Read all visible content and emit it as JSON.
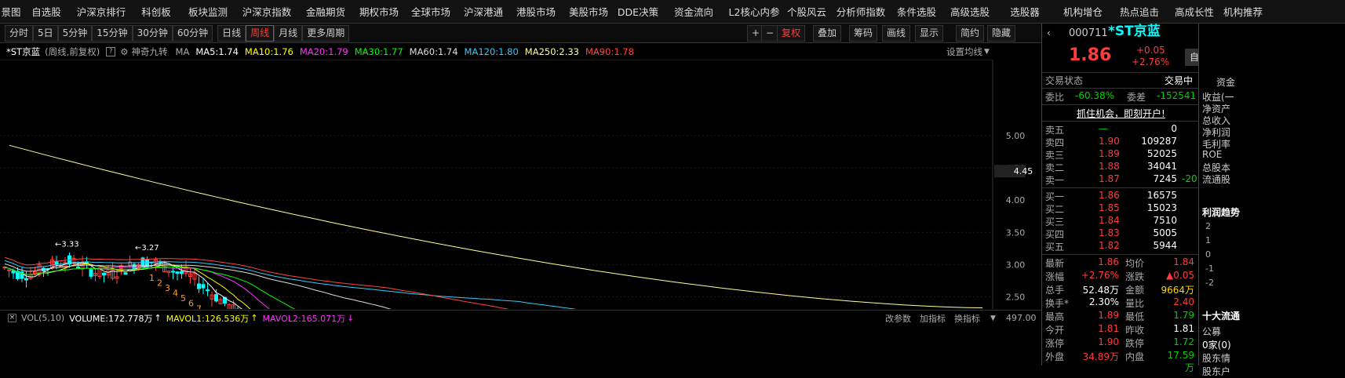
{
  "nav": [
    "景图",
    "自选股",
    "沪深京排行",
    "科创板",
    "板块监测",
    "沪深京指数",
    "金融期货",
    "期权市场",
    "全球市场",
    "沪深港通",
    "港股市场",
    "美股市场",
    "DDE决策",
    "资金流向",
    "L2核心内参",
    "个股风云",
    "分析师指数",
    "条件选股",
    "高级选股",
    "选股器",
    "机构增仓",
    "热点追击",
    "高成长性",
    "机构推荐"
  ],
  "toolbar": {
    "periods": [
      "分时",
      "5日",
      "5分钟",
      "15分钟",
      "30分钟",
      "60分钟",
      "日线",
      "周线",
      "月线",
      "更多周期"
    ],
    "active": "周线",
    "right": [
      "+",
      "−",
      "复权",
      "叠加",
      "筹码",
      "画线",
      "显示",
      "简约",
      "隐藏"
    ]
  },
  "info": {
    "name": "*ST京蓝",
    "mode": "(周线,前复权)",
    "indicator": "神奇九转",
    "ma_label": "MA",
    "ma": [
      {
        "t": "MA5:1.74",
        "c": "#ffffff"
      },
      {
        "t": "MA10:1.76",
        "c": "#ffff00"
      },
      {
        "t": "MA20:1.79",
        "c": "#ff33ff"
      },
      {
        "t": "MA30:1.77",
        "c": "#00ff00"
      },
      {
        "t": "MA60:1.74",
        "c": "#dddddd"
      },
      {
        "t": "MA120:1.80",
        "c": "#33ccff"
      },
      {
        "t": "MA250:2.33",
        "c": "#ffff99"
      },
      {
        "t": "MA90:1.78",
        "c": "#ff4444"
      }
    ],
    "setting": "设置均线"
  },
  "chart_data": {
    "type": "candlestick",
    "price_axis": [
      5.0,
      4.5,
      4.0,
      3.5,
      3.0,
      2.5,
      2.0,
      1.5
    ],
    "current_price_tag": "4.45",
    "annotations": [
      "3.33",
      "3.27",
      "2.26",
      "1.63",
      "1.31",
      "1.27",
      "1.75",
      "2.22",
      "2.16",
      "1.99",
      "1.942",
      "1.58",
      "1.36",
      "1.77"
    ],
    "seq_labels": [
      "1",
      "2",
      "3",
      "4",
      "5",
      "6",
      "7",
      "8"
    ],
    "ma250_start": 4.85,
    "ma250_end": 2.33
  },
  "vol": {
    "label": "VOL(5,10)",
    "volume": "VOLUME:172.778万",
    "mavol1": "MAVOL1:126.536万",
    "mavol2": "MAVOL2:165.071万",
    "links": [
      "改参数",
      "加指标",
      "换指标"
    ],
    "axis": "497.00"
  },
  "quote": {
    "code": "000711",
    "name": "*ST京蓝",
    "price": "1.86",
    "chg": "+0.05",
    "pct": "+2.76%",
    "btn": "自选",
    "state_label": "交易状态",
    "state": "交易中",
    "weibi_l": "委比",
    "weibi": "-60.38%",
    "weicha_l": "委差",
    "weicha": "-152541",
    "promo": "抓住机会，即刻开户!",
    "sells": [
      [
        "卖五",
        "—",
        "0"
      ],
      [
        "卖四",
        "1.90",
        "109287"
      ],
      [
        "卖三",
        "1.89",
        "52025"
      ],
      [
        "卖二",
        "1.88",
        "34041"
      ],
      [
        "卖一",
        "1.87",
        "7245",
        "-20"
      ]
    ],
    "buys": [
      [
        "买一",
        "1.86",
        "16575"
      ],
      [
        "买二",
        "1.85",
        "15023"
      ],
      [
        "买三",
        "1.84",
        "7510"
      ],
      [
        "买四",
        "1.83",
        "5005"
      ],
      [
        "买五",
        "1.82",
        "5944"
      ]
    ],
    "stats": [
      [
        "最新",
        "1.86",
        "均价",
        "1.84"
      ],
      [
        "涨幅",
        "+2.76%",
        "涨跌",
        "▲0.05"
      ],
      [
        "总手",
        "52.48万",
        "金额",
        "9664万"
      ],
      [
        "换手*",
        "2.30%",
        "量比",
        "2.40"
      ],
      [
        "最高",
        "1.89",
        "最低",
        "1.79"
      ],
      [
        "今开",
        "1.81",
        "昨收",
        "1.81"
      ],
      [
        "涨停",
        "1.90",
        "跌停",
        "1.72"
      ],
      [
        "外盘",
        "34.89万",
        "内盘",
        "17.59万"
      ]
    ]
  },
  "side": {
    "t": "资金",
    "items": [
      "收益(一",
      "净资产",
      "总收入",
      "净利润",
      "毛利率",
      "ROE",
      "总股本",
      "流通股"
    ],
    "profit": "利润趋势",
    "axis": [
      "2",
      "1",
      "0",
      "-1",
      "-2"
    ],
    "ten": "十大流通",
    "gd": "公募",
    "gd2": "0家(0)",
    "gd3": "股东情",
    "gd4": "股东户"
  }
}
